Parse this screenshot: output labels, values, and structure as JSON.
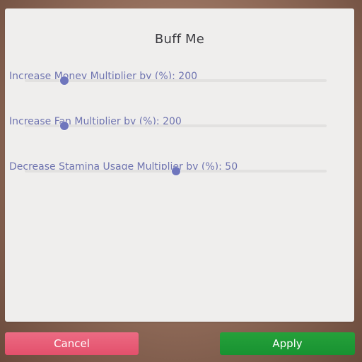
{
  "dialog": {
    "title": "Buff Me",
    "sliders": [
      {
        "label": "Increase Money Multiplier by (%):",
        "value": "200",
        "level": 0.13
      },
      {
        "label": "Increase Fan Multiplier by (%):",
        "value": "200",
        "level": 0.13
      },
      {
        "label": "Decrease Stamina Usage Multiplier by (%):",
        "value": "50",
        "level": 0.5
      }
    ]
  },
  "buttons": {
    "cancel_label": "Cancel",
    "apply_label": "Apply"
  },
  "colors": {
    "accent": "#6f76bd",
    "cancel": "#e55a74",
    "apply": "#1e9a35"
  }
}
